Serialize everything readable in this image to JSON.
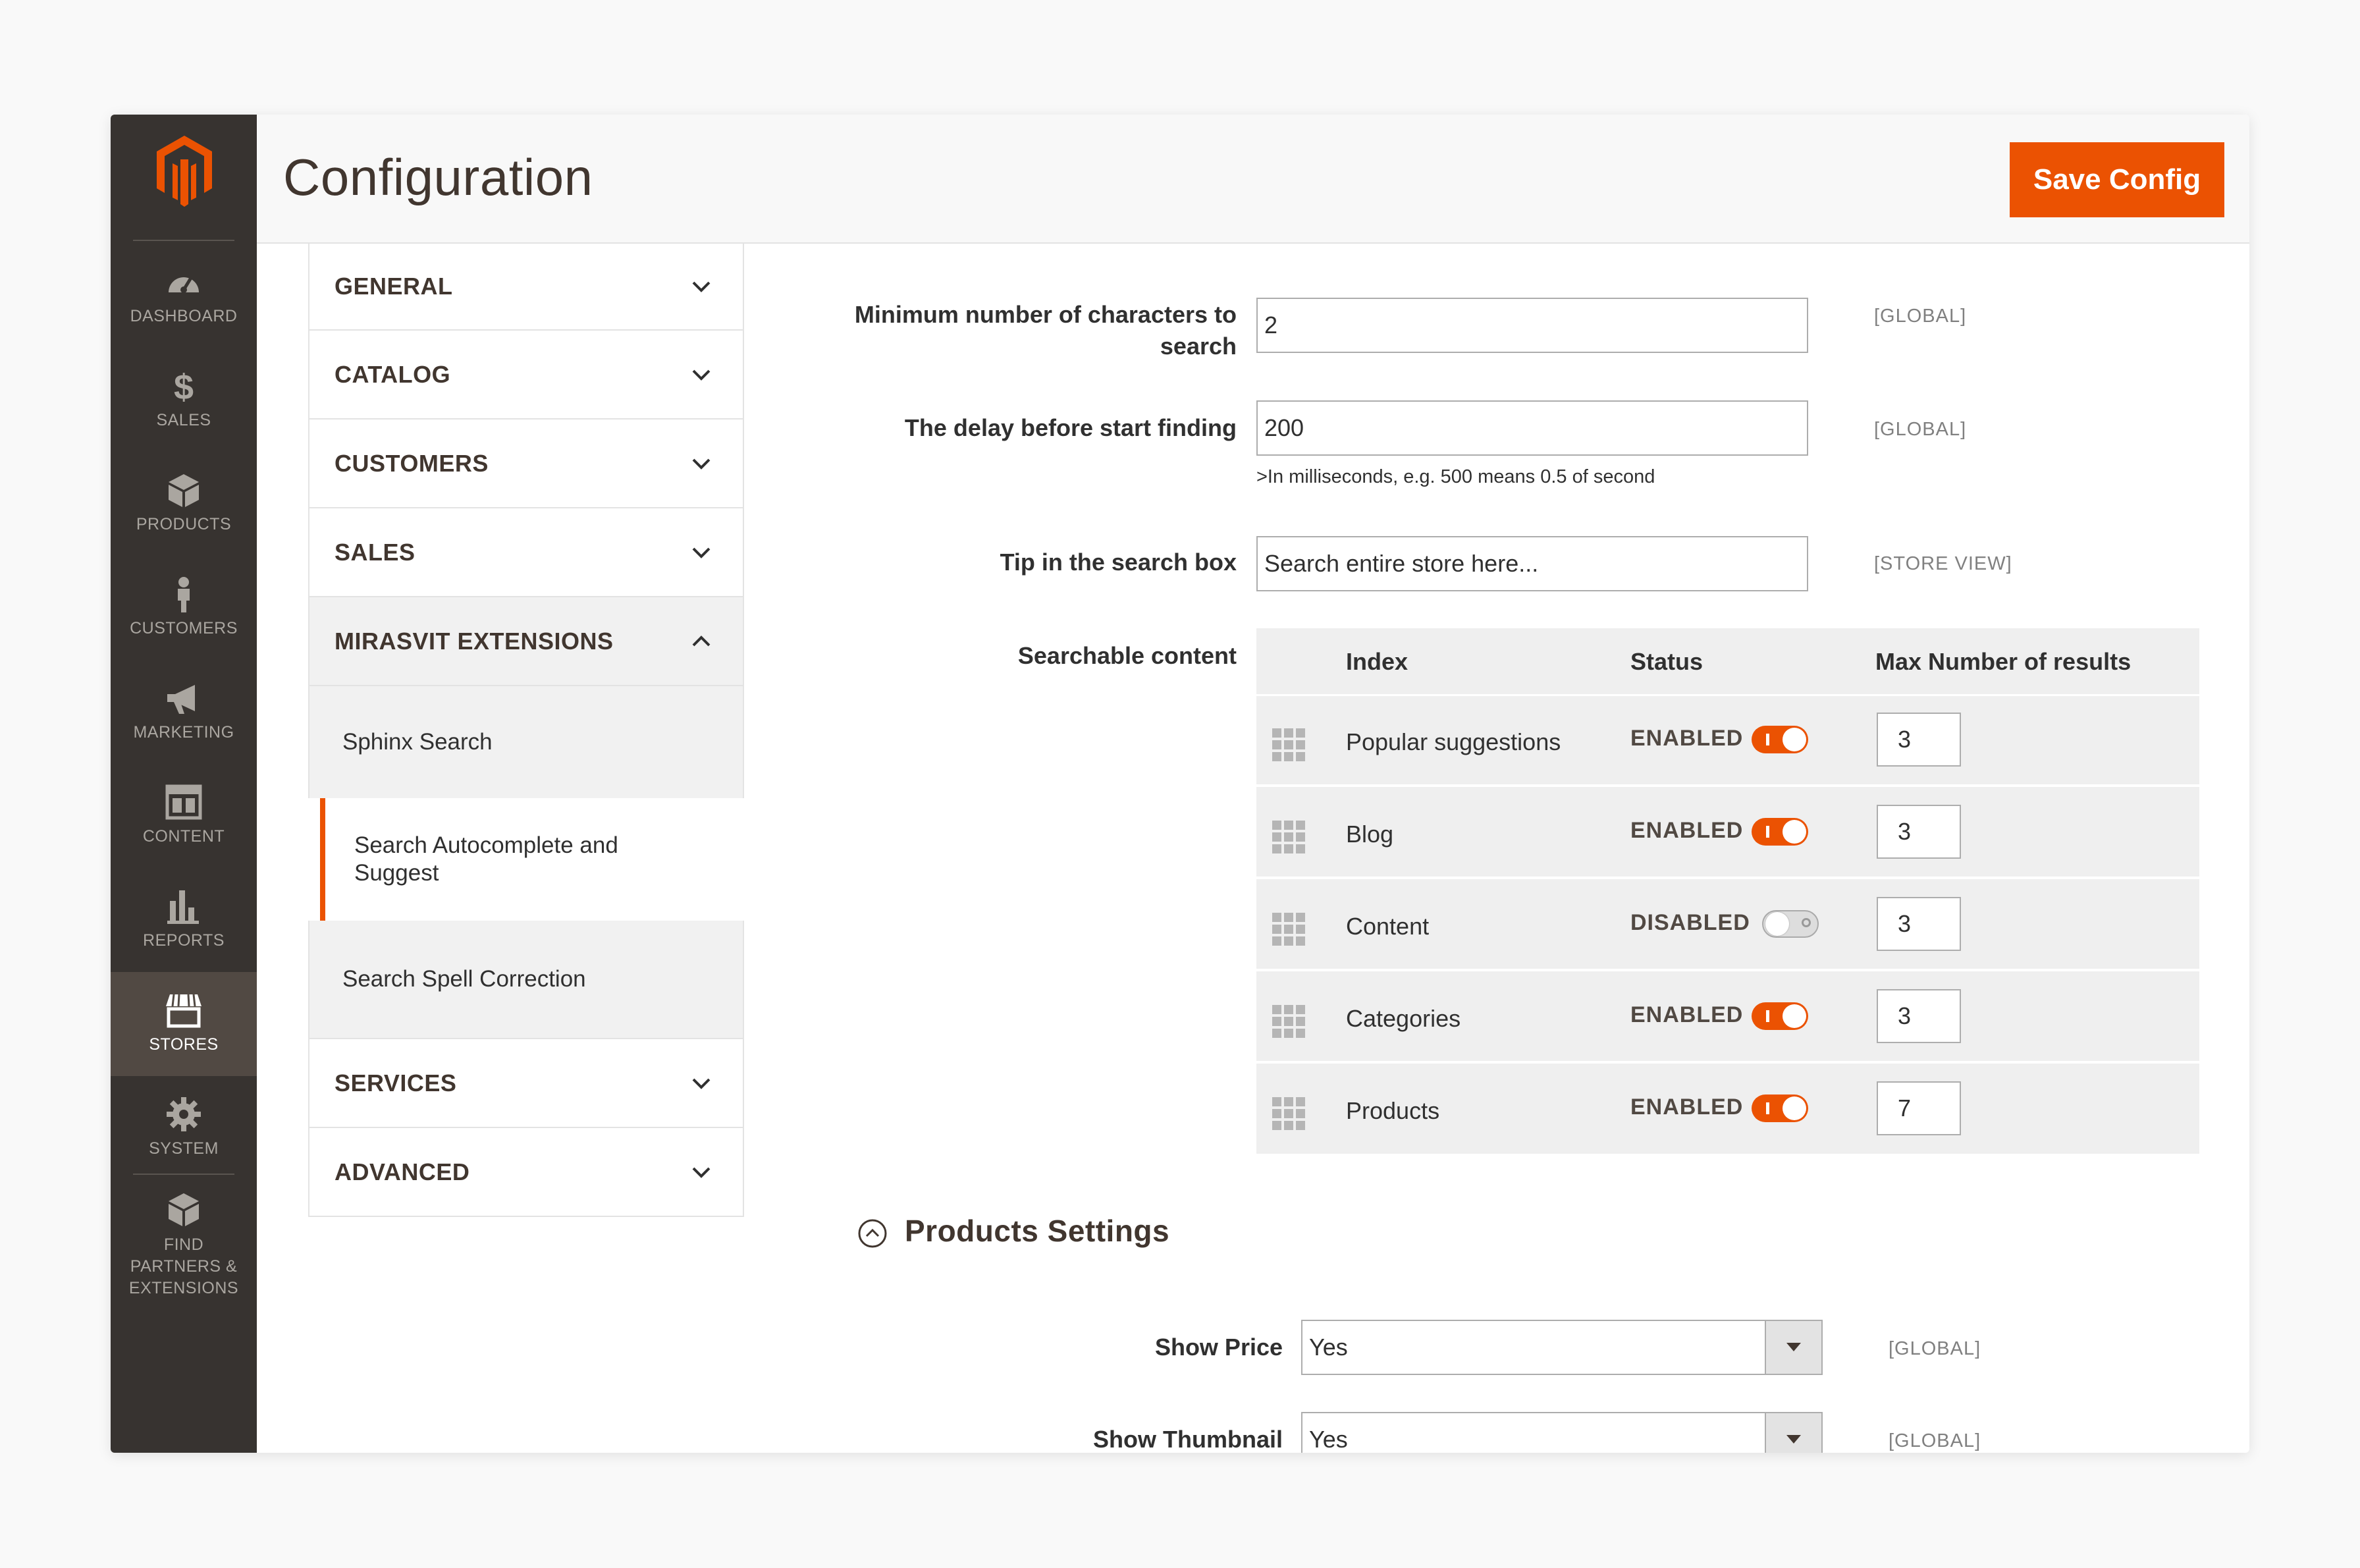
{
  "sidebar": {
    "items": [
      {
        "label": "DASHBOARD",
        "icon": "dashboard-icon"
      },
      {
        "label": "SALES",
        "icon": "dollar-icon"
      },
      {
        "label": "PRODUCTS",
        "icon": "box-icon"
      },
      {
        "label": "CUSTOMERS",
        "icon": "person-icon"
      },
      {
        "label": "MARKETING",
        "icon": "megaphone-icon"
      },
      {
        "label": "CONTENT",
        "icon": "layout-icon"
      },
      {
        "label": "REPORTS",
        "icon": "bar-chart-icon"
      },
      {
        "label": "STORES",
        "icon": "storefront-icon"
      },
      {
        "label": "SYSTEM",
        "icon": "gear-icon"
      },
      {
        "label": "FIND PARTNERS & EXTENSIONS",
        "icon": "cubes-icon"
      }
    ],
    "active": "STORES"
  },
  "header": {
    "title": "Configuration",
    "save_label": "Save Config"
  },
  "tabs": {
    "general": "GENERAL",
    "catalog": "CATALOG",
    "customers": "CUSTOMERS",
    "sales": "SALES",
    "mirasvit": "MIRASVIT EXTENSIONS",
    "sub": [
      "Sphinx Search",
      "Search Autocomplete and Suggest",
      "Search Spell Correction"
    ],
    "services": "SERVICES",
    "advanced": "ADVANCED"
  },
  "form": {
    "min_chars_label": "Minimum number of characters to search",
    "min_chars_value": "2",
    "min_chars_scope": "[GLOBAL]",
    "delay_label": "The delay before start finding",
    "delay_value": "200",
    "delay_scope": "[GLOBAL]",
    "delay_note": ">In milliseconds, e.g. 500 means 0.5 of second",
    "tip_label": "Tip in the search box",
    "tip_value": "Search entire store here...",
    "tip_scope": "[STORE VIEW]",
    "content_label": "Searchable content"
  },
  "grid": {
    "headers": {
      "index": "Index",
      "status": "Status",
      "max": "Max Number of results"
    },
    "rows": [
      {
        "index": "Popular suggestions",
        "status": "ENABLED",
        "enabled": true,
        "max": "3"
      },
      {
        "index": "Blog",
        "status": "ENABLED",
        "enabled": true,
        "max": "3"
      },
      {
        "index": "Content",
        "status": "DISABLED",
        "enabled": false,
        "max": "3"
      },
      {
        "index": "Categories",
        "status": "ENABLED",
        "enabled": true,
        "max": "3"
      },
      {
        "index": "Products",
        "status": "ENABLED",
        "enabled": true,
        "max": "7"
      }
    ]
  },
  "products_settings": {
    "title": "Products Settings",
    "show_price_label": "Show Price",
    "show_price_value": "Yes",
    "show_price_scope": "[GLOBAL]",
    "show_thumb_label": "Show Thumbnail",
    "show_thumb_value": "Yes",
    "show_thumb_scope": "[GLOBAL]"
  },
  "colors": {
    "accent": "#eb5202",
    "sidebar": "#373330",
    "sidebar_active": "#514943"
  }
}
